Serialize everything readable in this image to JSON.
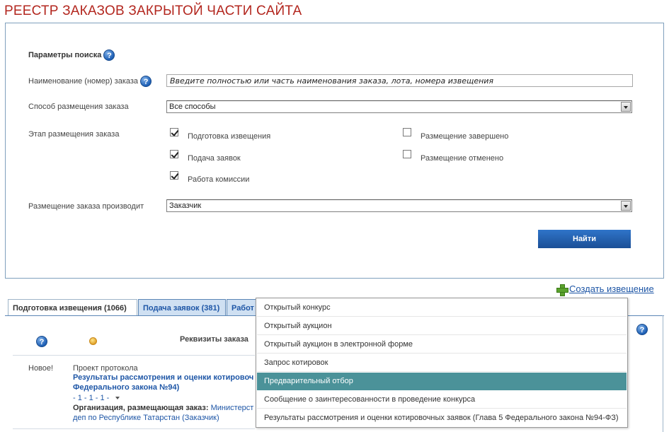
{
  "page_title": "РЕЕСТР ЗАКАЗОВ ЗАКРЫТОЙ ЧАСТИ САЙТА",
  "search": {
    "section_title": "Параметры поиска",
    "name_label": "Наименование (номер) заказа",
    "name_placeholder": "Введите полностью или часть наименования заказа, лота, номера извещения",
    "method_label": "Способ размещения заказа",
    "method_value": "Все способы",
    "stage_label": "Этап размещения заказа",
    "stages": [
      {
        "label": "Подготовка извещения",
        "checked": true
      },
      {
        "label": "Подача заявок",
        "checked": true
      },
      {
        "label": "Работа комиссии",
        "checked": true
      },
      {
        "label": "Размещение завершено",
        "checked": false
      },
      {
        "label": "Размещение отменено",
        "checked": false
      }
    ],
    "placer_label": "Размещение заказа производит",
    "placer_value": "Заказчик",
    "find_button": "Найти"
  },
  "create_link": "Создать извещение",
  "tabs": [
    {
      "label": "Подготовка извещения (1066)",
      "active": true
    },
    {
      "label": "Подача заявок (381)",
      "active": false
    },
    {
      "label": "Работ",
      "active": false
    }
  ],
  "results": {
    "column_header": "Реквизиты заказа",
    "row": {
      "status": "Новое!",
      "type": "Проект протокола",
      "title_line1": "Результаты рассмотрения и оценки котировоч",
      "title_line2": "Федерального закона №94)",
      "numbers": "- 1 - 1 - 1 - ",
      "org_label": "Организация, размещающая заказ:",
      "org_value": "Министерст",
      "org_value2": "деп по Республике Татарстан (Заказчик)"
    }
  },
  "dropdown_items": [
    {
      "label": "Открытый конкурс",
      "selected": false
    },
    {
      "label": "Открытый аукцион",
      "selected": false
    },
    {
      "label": "Открытый аукцион в электронной форме",
      "selected": false
    },
    {
      "label": "Запрос котировок",
      "selected": false
    },
    {
      "label": "Предварительный отбор",
      "selected": true
    },
    {
      "label": "Сообщение о заинтересованности в проведение конкурса",
      "selected": false
    },
    {
      "label": "Результаты рассмотрения и оценки котировочных заявок (Глава 5 Федерального закона №94-ФЗ)",
      "selected": false
    }
  ],
  "colors": {
    "title_red": "#b3271f",
    "link_blue": "#1e56a6",
    "button_blue": "#2f74c9",
    "dropdown_selected": "#4b9299"
  }
}
